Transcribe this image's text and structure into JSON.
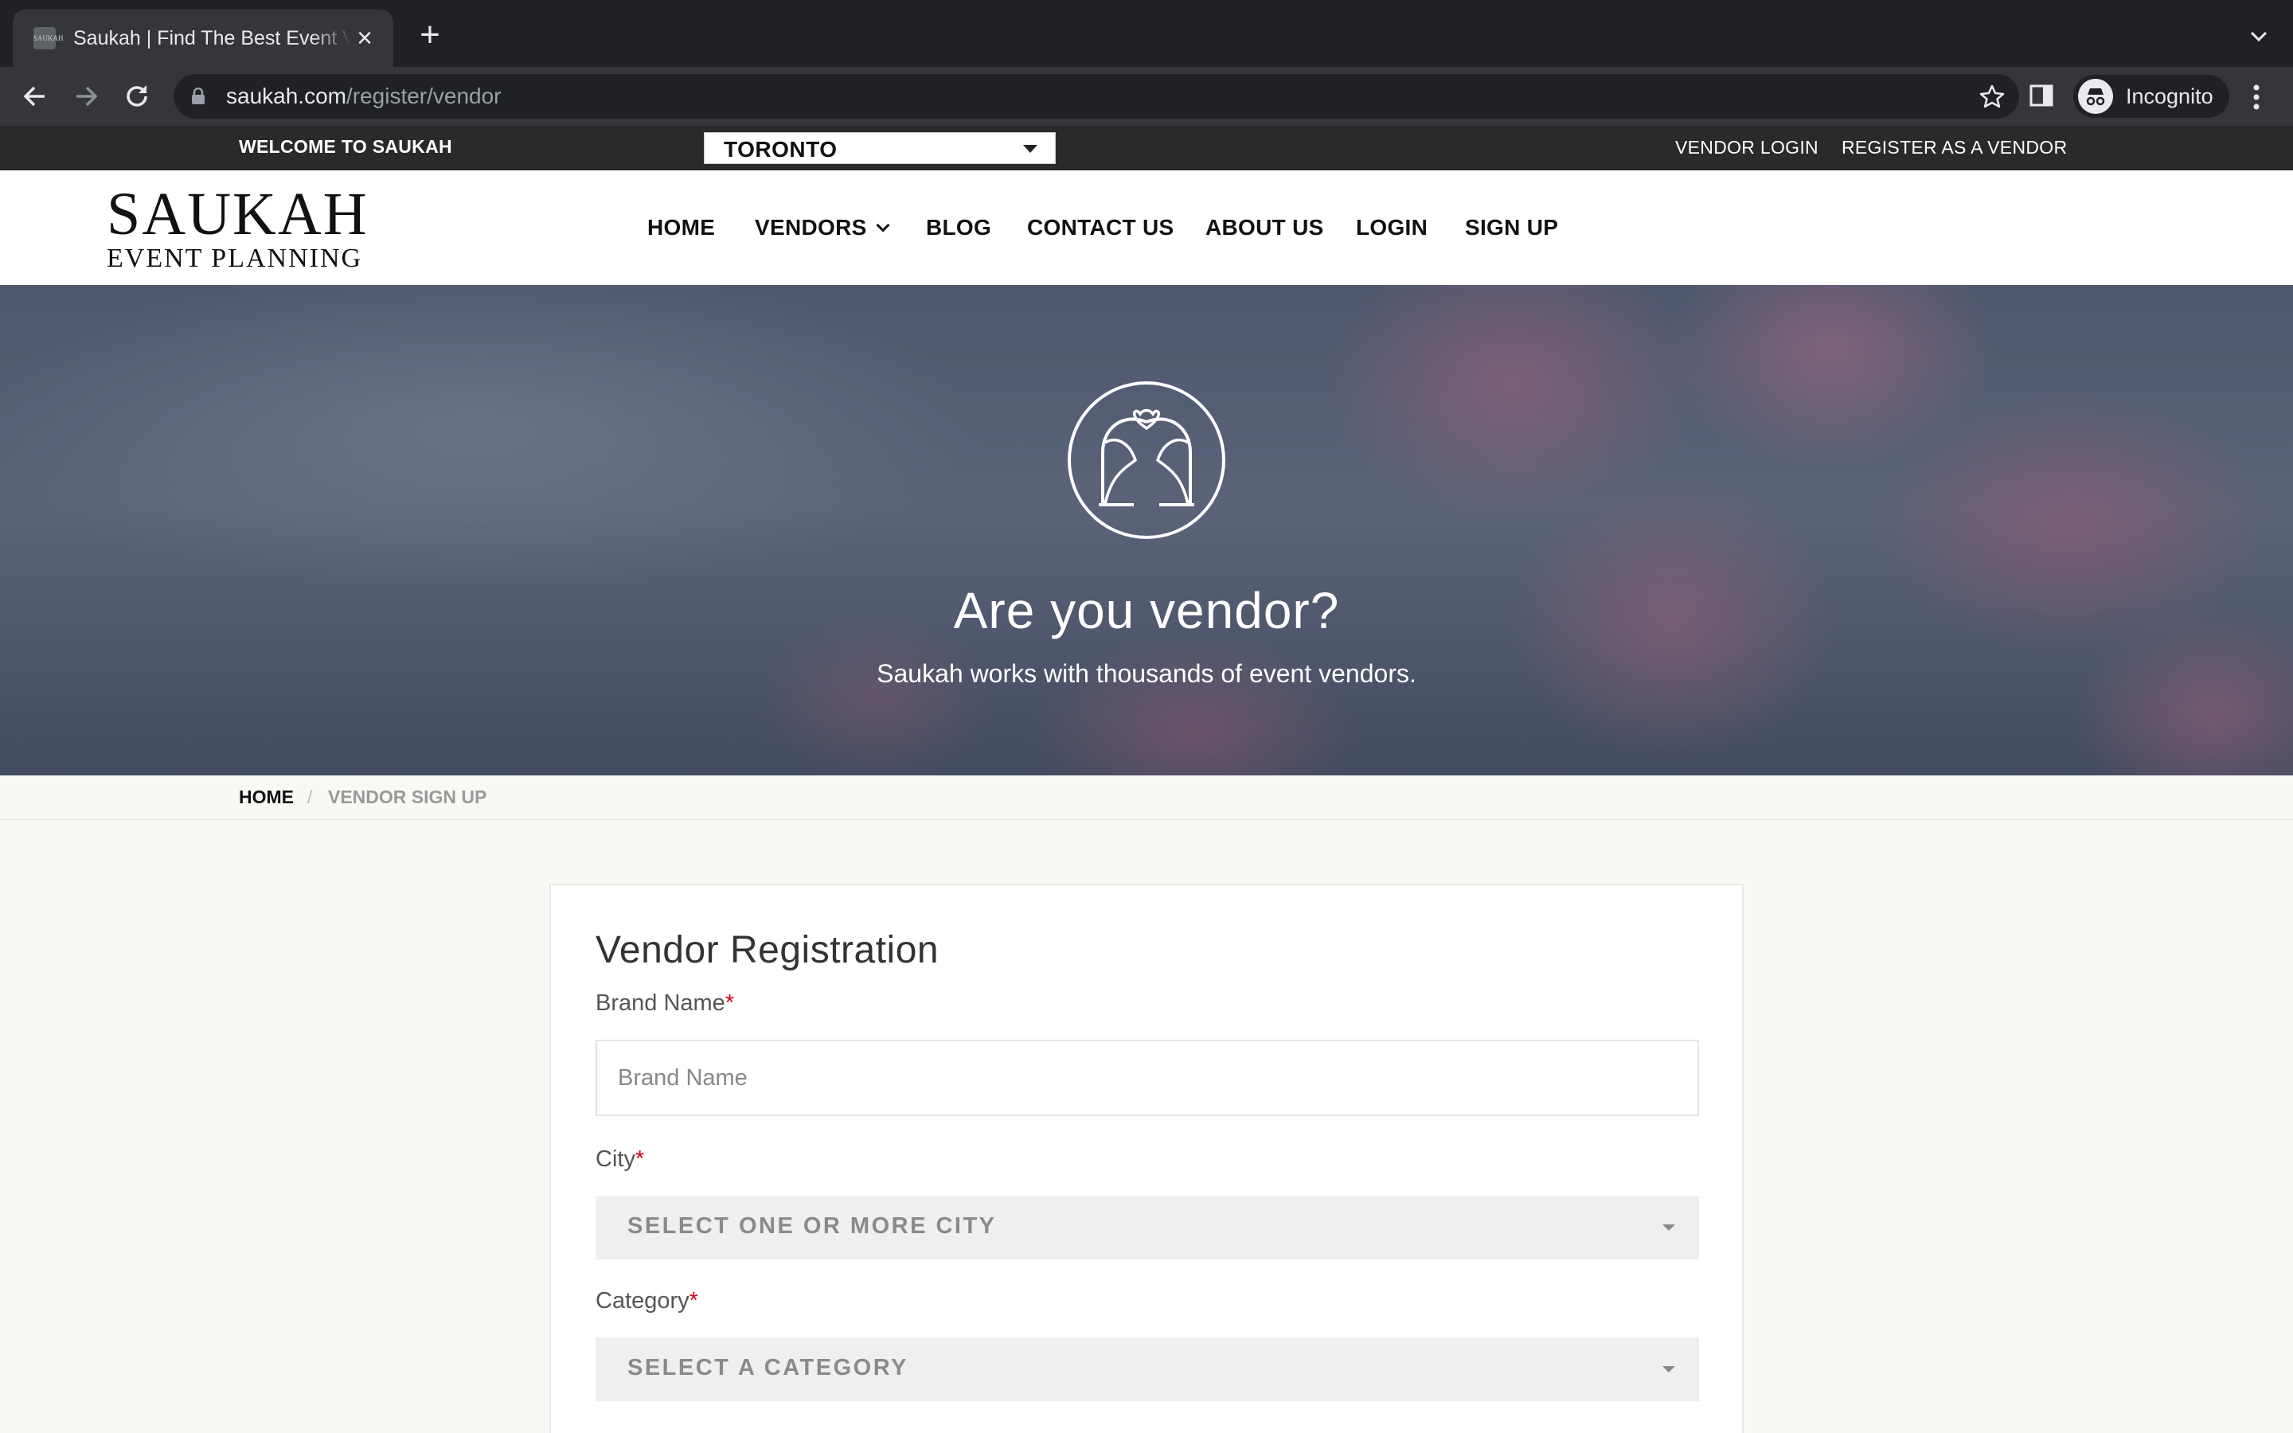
{
  "browser": {
    "tab_title": "Saukah | Find The Best Event Vendors",
    "favicon_text": "SAUKAH",
    "url_host": "saukah.com",
    "url_path": "/register/vendor",
    "profile_label": "Incognito"
  },
  "topbar": {
    "welcome": "WELCOME TO SAUKAH",
    "city_selected": "TORONTO",
    "links": [
      "VENDOR LOGIN",
      "REGISTER AS A VENDOR"
    ]
  },
  "logo": {
    "main": "SAUKAH",
    "sub": "EVENT PLANNING"
  },
  "nav": {
    "items": [
      "HOME",
      "VENDORS",
      "BLOG",
      "CONTACT US",
      "ABOUT US",
      "LOGIN",
      "SIGN UP"
    ]
  },
  "hero": {
    "title": "Are you vendor?",
    "subtitle": "Saukah works with thousands of event vendors."
  },
  "breadcrumb": {
    "home": "HOME",
    "separator": "/",
    "current": "VENDOR SIGN UP"
  },
  "form": {
    "title": "Vendor Registration",
    "required_mark": "*",
    "brand_label": "Brand Name",
    "brand_placeholder": "Brand Name",
    "city_label": "City",
    "city_placeholder": "SELECT ONE OR MORE CITY",
    "category_label": "Category",
    "category_placeholder": "SELECT A CATEGORY"
  },
  "colors": {
    "accent_required": "#d0021b",
    "topbar": "#2a2a2a",
    "chrome": "#35363a"
  }
}
